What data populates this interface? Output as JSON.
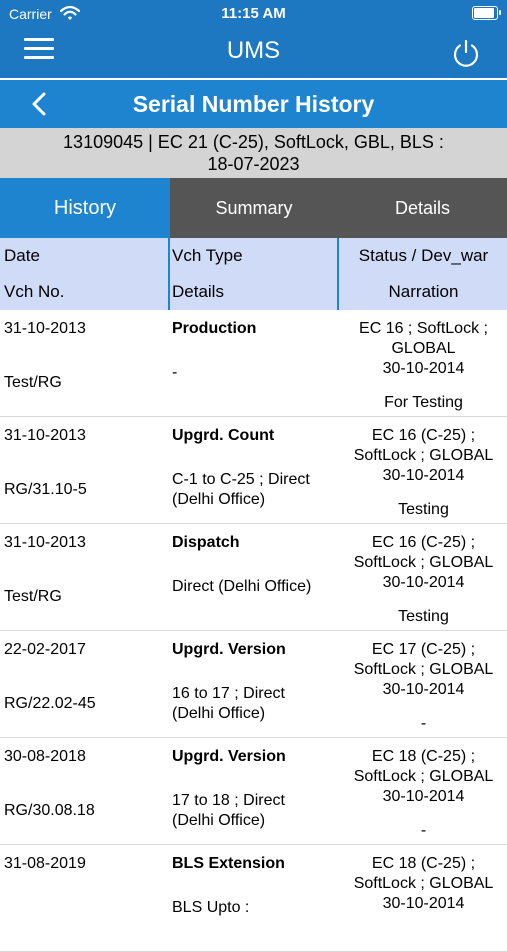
{
  "status_bar": {
    "carrier": "Carrier",
    "time": "11:15 AM"
  },
  "app_bar": {
    "title": "UMS"
  },
  "sub_header": {
    "title": "Serial Number History"
  },
  "info": {
    "line1": "13109045 | EC 21 (C-25), SoftLock, GBL, BLS :",
    "line2": "18-07-2023"
  },
  "tabs": [
    {
      "label": "History",
      "active": true
    },
    {
      "label": "Summary",
      "active": false
    },
    {
      "label": "Details",
      "active": false
    }
  ],
  "columns": {
    "date": "Date",
    "vch_no": "Vch No.",
    "vch_type": "Vch Type",
    "details": "Details",
    "status": "Status / Dev_war",
    "narration": "Narration"
  },
  "rows": [
    {
      "date": "31-10-2013",
      "vch_no": "Test/RG",
      "vch_type": "Production",
      "details": "-",
      "status": "EC 16 ; SoftLock ;\nGLOBAL\n30-10-2014",
      "narration": "For Testing"
    },
    {
      "date": "31-10-2013",
      "vch_no": "RG/31.10-5",
      "vch_type": "Upgrd. Count",
      "details": "C-1 to C-25 ; Direct\n(Delhi Office)",
      "status": "EC 16 (C-25) ;\nSoftLock ; GLOBAL\n30-10-2014",
      "narration": "Testing"
    },
    {
      "date": "31-10-2013",
      "vch_no": "Test/RG",
      "vch_type": "Dispatch",
      "details": "Direct (Delhi Office)",
      "status": "EC 16 (C-25) ;\nSoftLock ; GLOBAL\n30-10-2014",
      "narration": "Testing"
    },
    {
      "date": "22-02-2017",
      "vch_no": "RG/22.02-45",
      "vch_type": "Upgrd. Version",
      "details": "16 to 17 ; Direct\n(Delhi Office)",
      "status": "EC 17 (C-25) ;\nSoftLock ; GLOBAL\n30-10-2014",
      "narration": "-"
    },
    {
      "date": "30-08-2018",
      "vch_no": "RG/30.08.18",
      "vch_type": "Upgrd. Version",
      "details": "17 to 18 ; Direct\n(Delhi Office)",
      "status": "EC 18 (C-25) ;\nSoftLock ; GLOBAL\n30-10-2014",
      "narration": "-"
    },
    {
      "date": "31-08-2019",
      "vch_no": "",
      "vch_type": "BLS Extension",
      "details": "BLS Upto :",
      "status": "EC 18 (C-25) ;\nSoftLock ; GLOBAL\n30-10-2014",
      "narration": ""
    }
  ],
  "colors": {
    "primary": "#1d77c1",
    "tab_active": "#1e84d0",
    "tab_inactive": "#555555",
    "header_bg": "#cfdbf7",
    "info_bg": "#d4d4d4"
  }
}
